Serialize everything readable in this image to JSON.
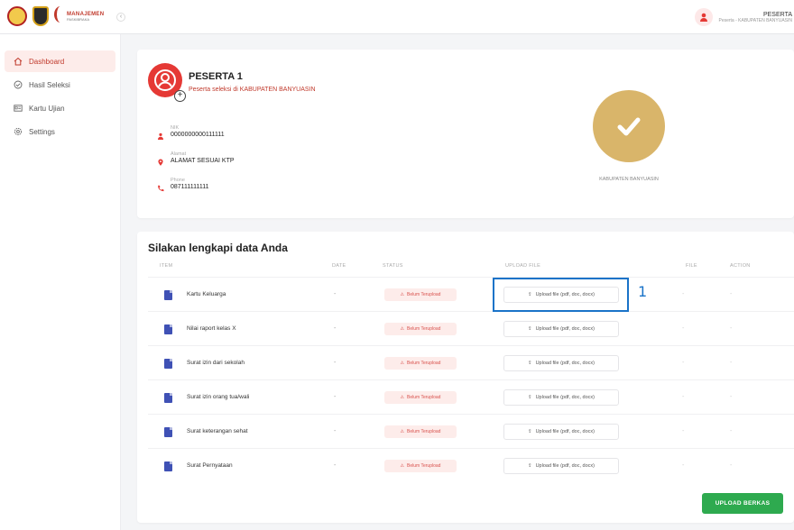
{
  "header": {
    "logo_title": "MANAJEMEN",
    "logo_subtitle": "PASKIBRAKA",
    "collapse_symbol": "‹",
    "user_name": "PESERTA",
    "user_sub": "Peserta - KABUPATEN BANYUASIN"
  },
  "sidebar": {
    "items": [
      {
        "label": "Dashboard",
        "icon": "home-icon",
        "active": true
      },
      {
        "label": "Hasil Seleksi",
        "icon": "check-circle-icon",
        "active": false
      },
      {
        "label": "Kartu Ujian",
        "icon": "id-card-icon",
        "active": false
      },
      {
        "label": "Settings",
        "icon": "gear-icon",
        "active": false
      }
    ]
  },
  "profile": {
    "name": "PESERTA 1",
    "subtitle": "Peserta seleksi di KABUPATEN BANYUASIN",
    "add_symbol": "+",
    "nik_label": "NIK",
    "nik_value": "0000000000111111",
    "alamat_label": "Alamat",
    "alamat_value": "ALAMAT SESUAI KTP",
    "phone_label": "Phone",
    "phone_value": "087111111111",
    "region": "KABUPATEN BANYUASIN",
    "colors": {
      "accent": "#e53935",
      "verified": "#d9b56a"
    }
  },
  "upload": {
    "title": "Silakan lengkapi data Anda",
    "columns": {
      "item": "ITEM",
      "date": "DATE",
      "status": "STATUS",
      "upload": "UPLOAD FILE",
      "file": "FILE",
      "action": "ACTION"
    },
    "rows": [
      {
        "name": "Kartu Keluarga",
        "date": "-",
        "status": "Belum Terupload",
        "upload": "Upload file (pdf, doc, docx)",
        "file": "-",
        "action": "-"
      },
      {
        "name": "Nilai raport kelas X",
        "date": "-",
        "status": "Belum Terupload",
        "upload": "Upload file (pdf, doc, docx)",
        "file": "-",
        "action": "-"
      },
      {
        "name": "Surat izin dari sekolah",
        "date": "-",
        "status": "Belum Terupload",
        "upload": "Upload file (pdf, doc, docx)",
        "file": "-",
        "action": "-"
      },
      {
        "name": "Surat izin orang tua/wali",
        "date": "-",
        "status": "Belum Terupload",
        "upload": "Upload file (pdf, doc, docx)",
        "file": "-",
        "action": "-"
      },
      {
        "name": "Surat keterangan sehat",
        "date": "-",
        "status": "Belum Terupload",
        "upload": "Upload file (pdf, doc, docx)",
        "file": "-",
        "action": "-"
      },
      {
        "name": "Surat Pernyataan",
        "date": "-",
        "status": "Belum Terupload",
        "upload": "Upload file (pdf, doc, docx)",
        "file": "-",
        "action": "-"
      }
    ],
    "submit_label": "UPLOAD BERKAS"
  },
  "annotation": {
    "label": "1",
    "color": "#1a73c8"
  }
}
